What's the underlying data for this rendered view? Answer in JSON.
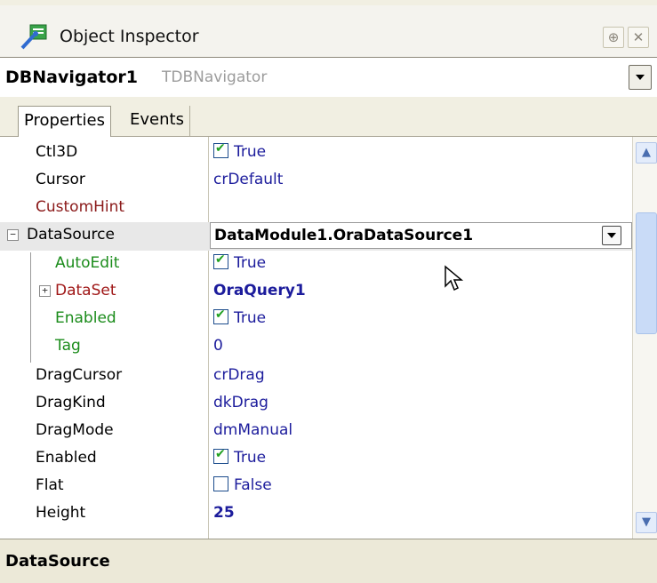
{
  "window": {
    "title": "Object Inspector"
  },
  "component": {
    "name": "DBNavigator1",
    "type": "TDBNavigator"
  },
  "tabs": [
    {
      "label": "Properties"
    },
    {
      "label": "Events"
    }
  ],
  "properties": [
    {
      "name": "Ctl3D",
      "value": "True",
      "checkbox": true
    },
    {
      "name": "Cursor",
      "value": "crDefault"
    },
    {
      "name": "CustomHint",
      "value": ""
    },
    {
      "name": "DataSource",
      "value": "DataModule1.OraDataSource1"
    },
    {
      "name": "AutoEdit",
      "value": "True",
      "checkbox": true
    },
    {
      "name": "DataSet",
      "value": "OraQuery1"
    },
    {
      "name": "Enabled",
      "value": "True",
      "checkbox": true
    },
    {
      "name": "Tag",
      "value": "0"
    },
    {
      "name": "DragCursor",
      "value": "crDrag"
    },
    {
      "name": "DragKind",
      "value": "dkDrag"
    },
    {
      "name": "DragMode",
      "value": "dmManual"
    },
    {
      "name": "Enabled",
      "value": "True",
      "checkbox": true
    },
    {
      "name": "Flat",
      "value": "False",
      "checkbox": false
    },
    {
      "name": "Height",
      "value": "25"
    }
  ],
  "status": {
    "text": "DataSource"
  },
  "colors": {
    "value_blue": "#1c1c9c",
    "custom_hint_red": "#8b1a1a",
    "dataset_red": "#a01818",
    "nested_green": "#1b8c1b"
  }
}
